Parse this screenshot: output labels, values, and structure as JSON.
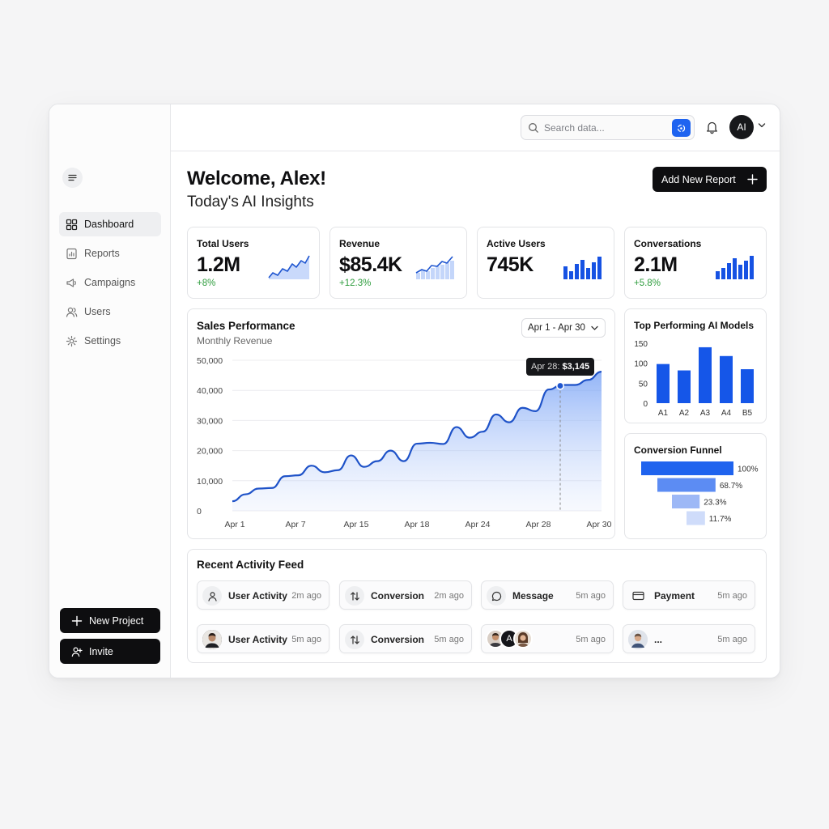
{
  "sidebar": {
    "items": [
      {
        "label": "Dashboard",
        "icon": "grid-icon",
        "active": true
      },
      {
        "label": "Reports",
        "icon": "report-icon"
      },
      {
        "label": "Campaigns",
        "icon": "megaphone-icon"
      },
      {
        "label": "Users",
        "icon": "users-icon"
      },
      {
        "label": "Settings",
        "icon": "gear-icon"
      }
    ],
    "new_project_label": "New Project",
    "invite_label": "Invite"
  },
  "header": {
    "search_placeholder": "Search data...",
    "avatar_initials": "AI"
  },
  "page": {
    "welcome": "Welcome, Alex!",
    "subtitle": "Today's AI Insights",
    "add_report_label": "Add New Report"
  },
  "stats": [
    {
      "label": "Total Users",
      "value": "1.2M",
      "change": "+8%",
      "spark": "line"
    },
    {
      "label": "Revenue",
      "value": "$85.4K",
      "change": "+12.3%",
      "spark": "line-bars"
    },
    {
      "label": "Active Users",
      "value": "745K",
      "change": "",
      "spark": "bars"
    },
    {
      "label": "Conversations",
      "value": "2.1M",
      "change": "+5.8%",
      "spark": "bars"
    }
  ],
  "sales": {
    "title": "Sales Performance",
    "subtitle": "Monthly Revenue",
    "date_range": "Apr 1 - Apr 30",
    "tooltip_date": "Apr 28:",
    "tooltip_value": "$3,145"
  },
  "chart_data": [
    {
      "type": "area",
      "title": "Sales Performance",
      "subtitle": "Monthly Revenue",
      "x_ticks": [
        "Apr 1",
        "Apr 7",
        "Apr 15",
        "Apr 18",
        "Apr 24",
        "Apr 28",
        "Apr 30"
      ],
      "y_ticks": [
        "0",
        "10,000",
        "20,000",
        "30,000",
        "40,000",
        "50,000"
      ],
      "ylim": [
        0,
        50000
      ],
      "series": [
        {
          "values": [
            3200,
            5500,
            7400,
            7600,
            11500,
            11800,
            15000,
            12800,
            13500,
            18400,
            14600,
            16500,
            20000,
            16500,
            22300,
            22600,
            22200,
            27800,
            24300,
            26300,
            32000,
            29400,
            34200,
            33100,
            40300,
            41800,
            41800,
            43500,
            46200
          ]
        }
      ],
      "highlight": {
        "x": "Apr 28",
        "y": 41500
      },
      "color": "#1e52c8",
      "grid": true
    },
    {
      "type": "bar",
      "title": "Top Performing AI Models",
      "categories": [
        "A1",
        "A2",
        "A3",
        "A4",
        "B5"
      ],
      "values": [
        98,
        82,
        140,
        118,
        85
      ],
      "ylim": [
        0,
        150
      ],
      "y_ticks": [
        "0",
        "50",
        "100",
        "150"
      ],
      "color": "#1556e8"
    },
    {
      "type": "bar",
      "title": "Conversion Funnel",
      "categories": [
        "100%",
        "68.7%",
        "23.3%",
        "11.7%"
      ],
      "values": [
        100,
        68.7,
        23.3,
        11.7
      ],
      "orientation": "horizontal-funnel",
      "colors": [
        "#1f63ee",
        "#5c8cf3",
        "#9db8f6",
        "#cfdcfa"
      ]
    }
  ],
  "feed": {
    "title": "Recent Activity Feed",
    "items": [
      {
        "name": "User Activity",
        "time": "2m ago",
        "icon": "user-icon"
      },
      {
        "name": "Conversion",
        "time": "2m ago",
        "icon": "swap-icon"
      },
      {
        "name": "Message",
        "time": "5m ago",
        "icon": "chat-icon"
      },
      {
        "name": "Payment",
        "time": "5m ago",
        "icon": "card-icon"
      },
      {
        "name": "User Activity",
        "time": "5m ago",
        "icon": "avatar-photo"
      },
      {
        "name": "Conversion",
        "time": "5m ago",
        "icon": "swap-icon"
      },
      {
        "name": "",
        "time": "5m ago",
        "icon": "avatar-group",
        "group_initial": "A"
      },
      {
        "name": "...",
        "time": "5m ago",
        "icon": "avatar-photo"
      }
    ]
  }
}
